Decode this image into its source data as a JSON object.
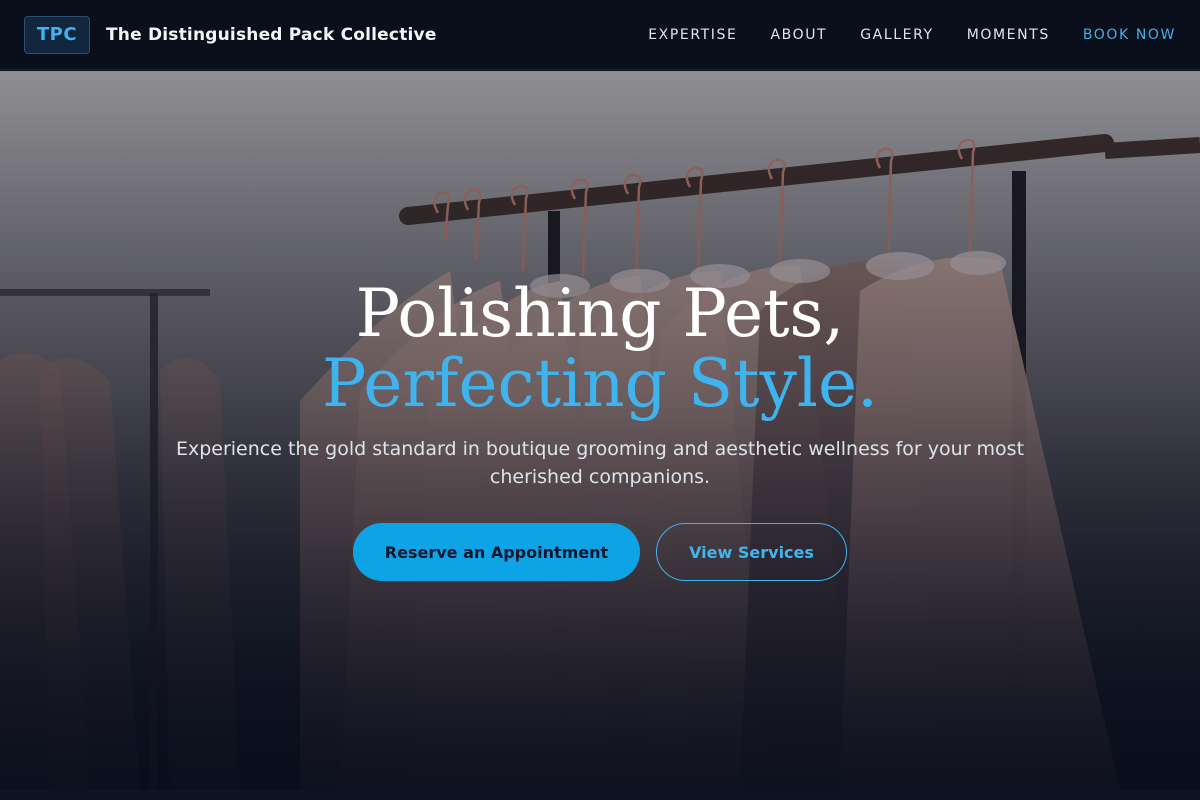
{
  "nav": {
    "logo_text": "TPC",
    "brand": "The Distinguished Pack Collective",
    "links": [
      "EXPERTISE",
      "ABOUT",
      "GALLERY",
      "MOMENTS"
    ],
    "cta": "BOOK NOW"
  },
  "hero": {
    "headline_main": "Polishing Pets, ",
    "headline_accent": "Perfecting Style.",
    "subtitle": "Experience the gold standard in boutique grooming and aesthetic wellness for your most cherished companions.",
    "primary_button": "Reserve an Appointment",
    "secondary_button": "View Services",
    "background_image": "clothing-rack-garments"
  },
  "colors": {
    "accent": "#3fb3ee",
    "primary_button_bg": "#0ea3e4",
    "nav_bg": "#0a101b"
  }
}
